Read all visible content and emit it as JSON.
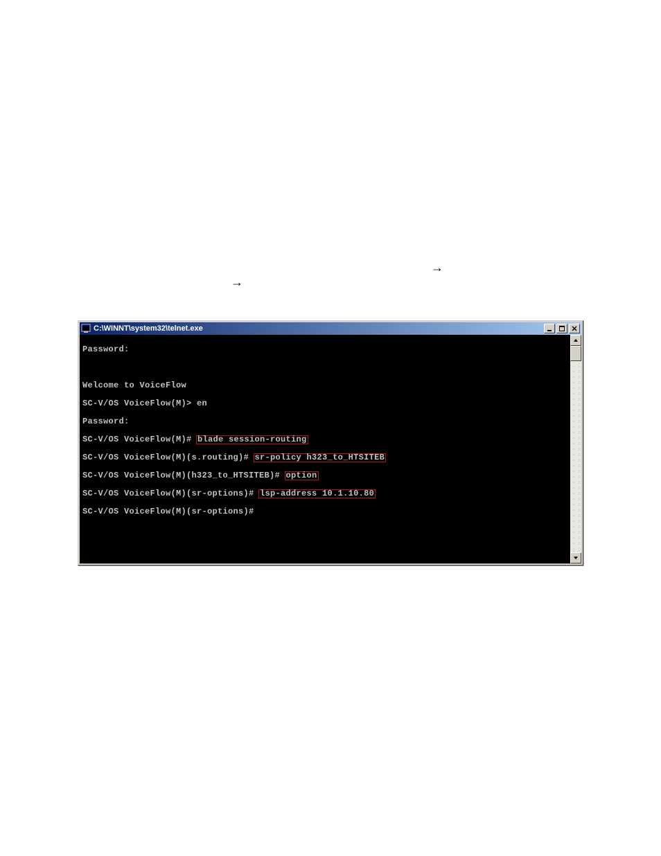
{
  "arrows": {
    "a1": "→",
    "a2": "→"
  },
  "window": {
    "title": "C:\\WINNT\\system32\\telnet.exe",
    "buttons": {
      "min": "minimize",
      "max": "maximize",
      "close": "close"
    }
  },
  "terminal": {
    "lines": [
      {
        "prompt": "Password:",
        "cmd": null
      },
      {
        "prompt": "",
        "cmd": null
      },
      {
        "prompt": "Welcome to VoiceFlow",
        "cmd": null
      },
      {
        "prompt": "SC-V/OS VoiceFlow(M)> en",
        "cmd": null
      },
      {
        "prompt": "Password:",
        "cmd": null
      },
      {
        "prompt": "SC-V/OS VoiceFlow(M)# ",
        "cmd": "blade session-routing"
      },
      {
        "prompt": "SC-V/OS VoiceFlow(M)(s.routing)# ",
        "cmd": "sr-policy h323_to_HTSITEB"
      },
      {
        "prompt": "SC-V/OS VoiceFlow(M)(h323_to_HTSITEB)# ",
        "cmd": "option"
      },
      {
        "prompt": "SC-V/OS VoiceFlow(M)(sr-options)# ",
        "cmd": "lsp-address 10.1.10.80"
      },
      {
        "prompt": "SC-V/OS VoiceFlow(M)(sr-options)#",
        "cmd": null
      }
    ]
  }
}
